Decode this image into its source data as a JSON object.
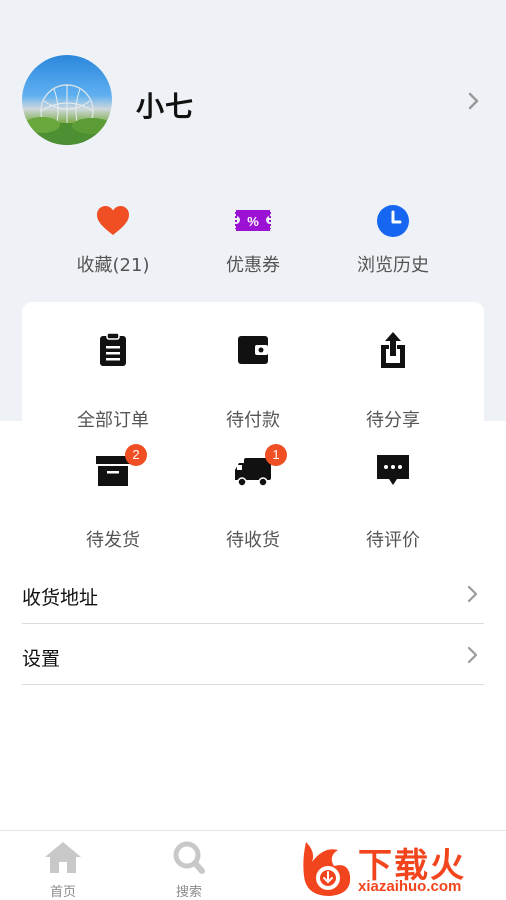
{
  "colors": {
    "accent_red": "#f04e23",
    "coupon_purple": "#9b12d4",
    "history_blue": "#1766f2",
    "header_bg": "#eef1f5"
  },
  "profile": {
    "name": "小七"
  },
  "quick_links": [
    {
      "label": "收藏(21)",
      "icon": "heart-icon"
    },
    {
      "label": "优惠券",
      "icon": "coupon-icon"
    },
    {
      "label": "浏览历史",
      "icon": "clock-icon"
    }
  ],
  "orders": [
    {
      "label": "全部订单",
      "icon": "clipboard-icon"
    },
    {
      "label": "待付款",
      "icon": "wallet-icon"
    },
    {
      "label": "待分享",
      "icon": "share-icon"
    },
    {
      "label": "待发货",
      "icon": "box-icon",
      "badge": "2"
    },
    {
      "label": "待收货",
      "icon": "truck-icon",
      "badge": "1"
    },
    {
      "label": "待评价",
      "icon": "comment-icon"
    }
  ],
  "menu": [
    {
      "label": "收货地址"
    },
    {
      "label": "设置"
    }
  ],
  "tabbar": [
    {
      "label": "首页",
      "icon": "home-icon"
    },
    {
      "label": "搜索",
      "icon": "search-icon"
    }
  ],
  "watermark": {
    "text": "下载火",
    "url": "xiazaihuo.com"
  }
}
